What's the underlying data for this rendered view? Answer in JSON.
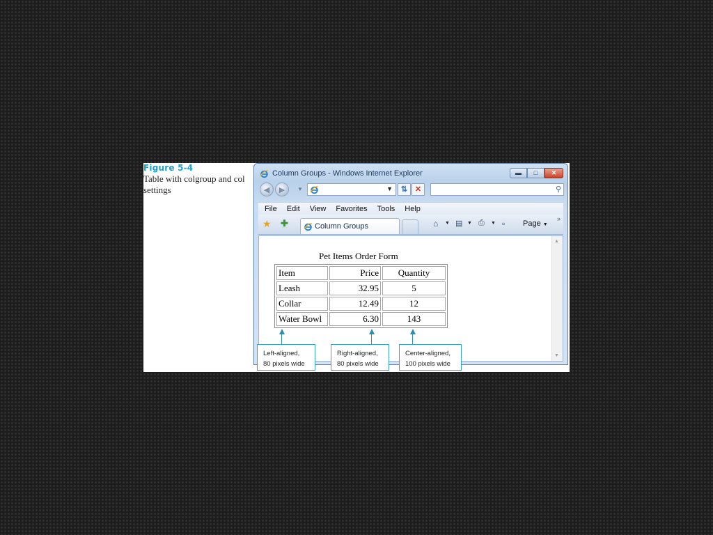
{
  "figure": {
    "number": "Figure 5-4",
    "caption": "Table with colgroup and col settings"
  },
  "browser": {
    "window_title": "Column Groups - Windows Internet Explorer",
    "address_value": "",
    "search_placeholder": "",
    "menu": [
      "File",
      "Edit",
      "View",
      "Favorites",
      "Tools",
      "Help"
    ],
    "tab_title": "Column Groups",
    "page_menu_label": "Page"
  },
  "page": {
    "form_title": "Pet Items Order Form",
    "table": {
      "headers": [
        "Item",
        "Price",
        "Quantity"
      ],
      "rows": [
        [
          "Leash",
          "32.95",
          "5"
        ],
        [
          "Collar",
          "12.49",
          "12"
        ],
        [
          "Water Bowl",
          "6.30",
          "143"
        ]
      ]
    }
  },
  "callouts": [
    {
      "line1": "Left-aligned,",
      "line2": "80 pixels wide"
    },
    {
      "line1": "Right-aligned,",
      "line2": "80 pixels wide"
    },
    {
      "line1": "Center-aligned,",
      "line2": "100 pixels wide"
    }
  ],
  "icons": {
    "browser_logo": "ie-logo-icon",
    "back": "back-arrow-icon",
    "forward": "forward-arrow-icon",
    "refresh": "refresh-icon",
    "stop": "stop-icon",
    "search": "search-icon",
    "favorites": "favorites-star-icon",
    "add_favorites": "add-favorites-icon",
    "home": "home-icon",
    "feeds": "feeds-icon",
    "print": "print-icon",
    "page": "page-icon"
  },
  "colors": {
    "figure_label": "#1da0c9",
    "callout_border": "#35a3c4",
    "stop": "#c8321e",
    "close_button": "#c8442a"
  }
}
